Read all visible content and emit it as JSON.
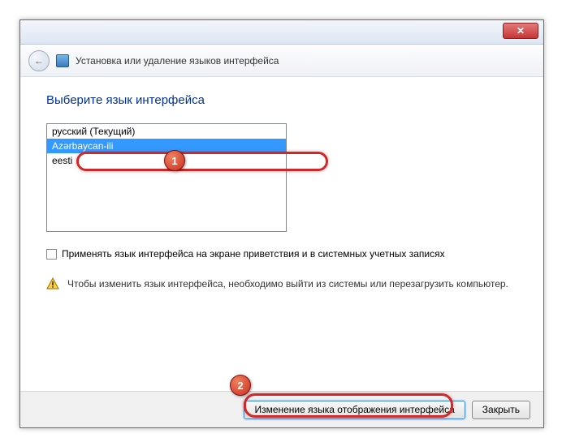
{
  "header": {
    "title": "Установка или удаление языков интерфейса"
  },
  "page": {
    "heading": "Выберите язык интерфейса"
  },
  "languages": {
    "items": [
      {
        "label": "русский (Текущий)",
        "selected": false
      },
      {
        "label": "Azərbaycan-ili",
        "selected": true
      },
      {
        "label": "eesti",
        "selected": false
      }
    ]
  },
  "checkbox": {
    "label": "Применять язык интерфейса на экране приветствия и в системных учетных записях"
  },
  "warning": {
    "text": "Чтобы изменить язык интерфейса, необходимо выйти из системы или перезагрузить компьютер."
  },
  "footer": {
    "primary": "Изменение языка отображения интерфейса",
    "close": "Закрыть"
  },
  "callouts": {
    "b1": "1",
    "b2": "2"
  }
}
